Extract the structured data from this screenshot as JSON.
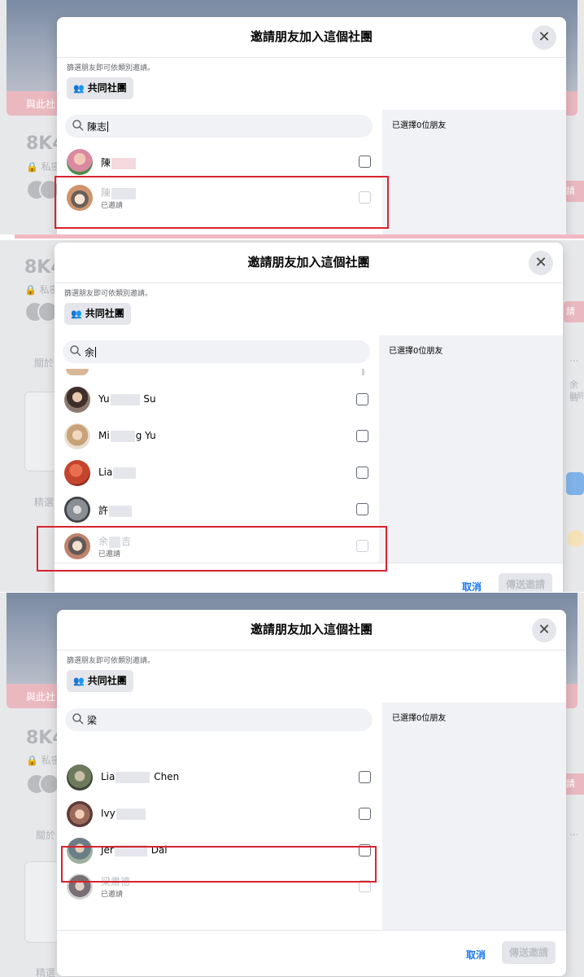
{
  "modal": {
    "title": "邀請朋友加入這個社團",
    "hint": "篩選朋友即可依類別邀請。",
    "group_filter_label": "共同社團",
    "selected_count_text": "已選擇0位朋友",
    "cancel_label": "取消",
    "send_label": "傳送邀請",
    "invited_label": "已邀請"
  },
  "background": {
    "group_title_fragment": "8K4",
    "strip_text": "與此社",
    "privacy_fragment": "私密",
    "pill_text": "請",
    "about_fragment": "關於",
    "featured_fragment": "精選",
    "side_name_fragment": "余翁",
    "side_sub_fragment": "目前",
    "dots": "..."
  },
  "panels": [
    {
      "search_value": "陳志",
      "rows": [
        {
          "name": "陳",
          "status": "",
          "invited": false,
          "avatar_color": "#d98aa0"
        },
        {
          "name": "陳",
          "status": "已邀請",
          "invited": true,
          "avatar_color": "#c0703a"
        }
      ]
    },
    {
      "search_value": "余",
      "rows": [
        {
          "name_start": "Yu",
          "name_end": "Su",
          "status": "",
          "invited": false,
          "avatar_color": "#5a4a44"
        },
        {
          "name_start": "Mi",
          "name_end": "g Yu",
          "status": "",
          "invited": false,
          "avatar_color": "#c9a27a"
        },
        {
          "name_start": "Lia",
          "name_end": "",
          "status": "",
          "invited": false,
          "avatar_color": "#c4452e"
        },
        {
          "name_start": "許",
          "name_end": "",
          "status": "",
          "invited": false,
          "avatar_color": "#8a8f94"
        },
        {
          "name_start": "余",
          "name_end": "吉",
          "status": "已邀請",
          "invited": true,
          "avatar_color": "#a8583c"
        }
      ]
    },
    {
      "search_value": "梁",
      "rows": [
        {
          "name_start": "Lia",
          "name_end": "Chen",
          "status": "",
          "invited": false,
          "avatar_color": "#6e7a5c"
        },
        {
          "name_start": "Ivy",
          "name_end": "",
          "status": "",
          "invited": false,
          "avatar_color": "#9a6a5a"
        },
        {
          "name_start": "Jer",
          "name_end": "Dai",
          "status": "",
          "invited": false,
          "avatar_color": "#6b7d86"
        },
        {
          "name_start": "梁肅德",
          "name_end": "",
          "status": "已邀請",
          "invited": true,
          "avatar_color": "#4a3f44"
        }
      ]
    }
  ],
  "colors": {
    "accent": "#1877f2",
    "highlight": "#d9232f"
  }
}
